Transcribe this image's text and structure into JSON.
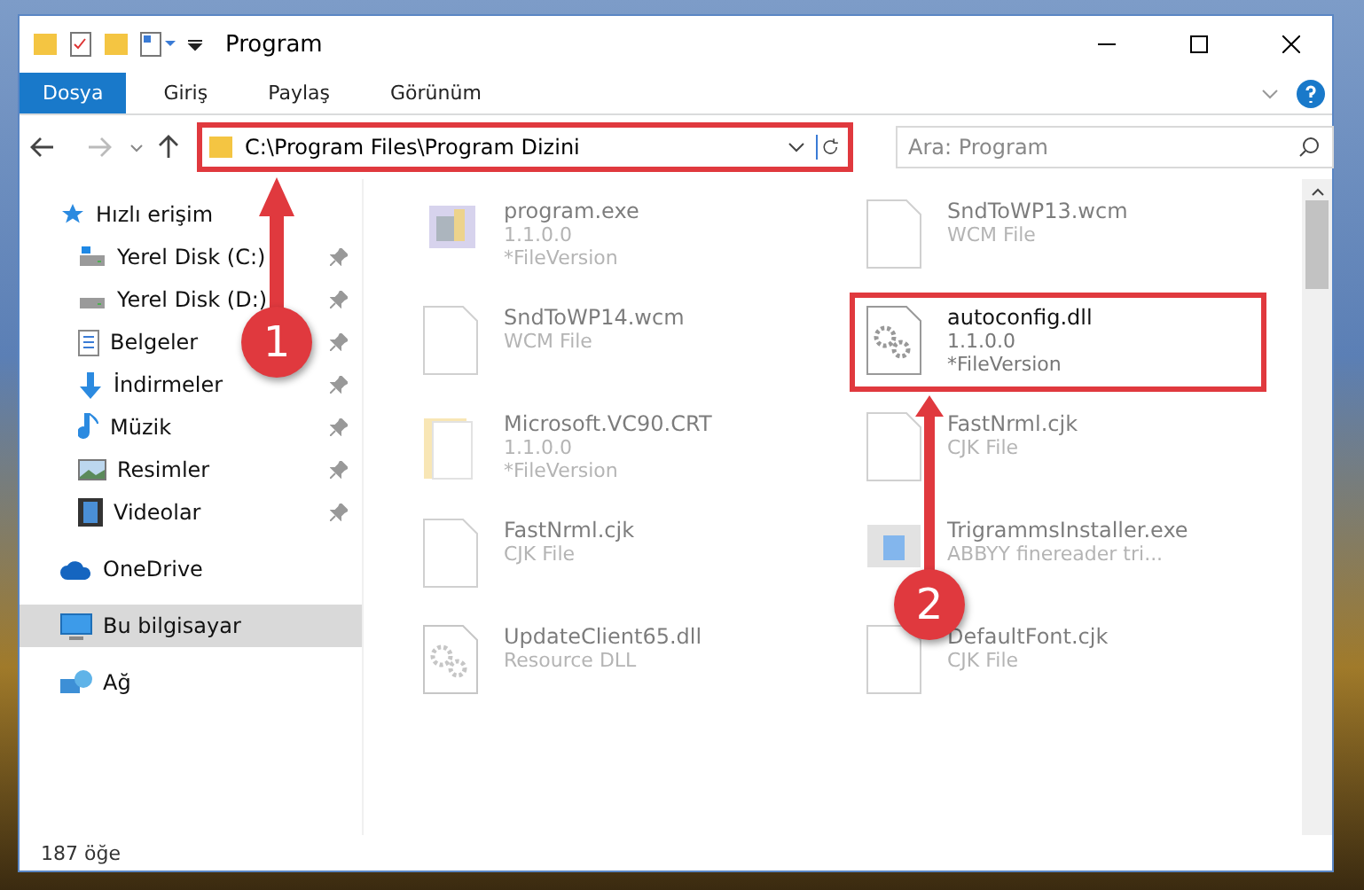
{
  "window": {
    "title": "Program"
  },
  "ribbon_tabs": [
    {
      "label": "Dosya",
      "selected": true
    },
    {
      "label": "Giriş",
      "selected": false
    },
    {
      "label": "Paylaş",
      "selected": false
    },
    {
      "label": "Görünüm",
      "selected": false
    }
  ],
  "address_bar": {
    "path": "C:\\Program Files\\Program Dizini",
    "highlighted": true
  },
  "search": {
    "placeholder": "Ara: Program"
  },
  "navigation": [
    {
      "label": "Hızlı erişim",
      "kind": "star",
      "selected": false,
      "children": [
        {
          "label": "Yerel Disk (C:)",
          "kind": "drivec",
          "pinned": true
        },
        {
          "label": "Yerel Disk (D:)",
          "kind": "drive",
          "pinned": true
        },
        {
          "label": "Belgeler",
          "kind": "document",
          "pinned": true
        },
        {
          "label": "İndirmeler",
          "kind": "download",
          "pinned": true
        },
        {
          "label": "Müzik",
          "kind": "music",
          "pinned": true
        },
        {
          "label": "Resimler",
          "kind": "picture",
          "pinned": true
        },
        {
          "label": "Videolar",
          "kind": "video",
          "pinned": true
        }
      ]
    },
    {
      "label": "OneDrive",
      "kind": "cloud",
      "selected": false
    },
    {
      "label": "Bu bilgisayar",
      "kind": "computer",
      "selected": true
    },
    {
      "label": "Ağ",
      "kind": "network",
      "selected": false
    }
  ],
  "files": [
    {
      "name": "program.exe",
      "details": [
        "1.1.0.0",
        "*FileVersion"
      ],
      "kind": "app",
      "highlighted": false,
      "blurred": true
    },
    {
      "name": "SndToWP13.wcm",
      "details": [
        "WCM File"
      ],
      "kind": "file",
      "highlighted": false,
      "blurred": true
    },
    {
      "name": "SndToWP14.wcm",
      "details": [
        "WCM File"
      ],
      "kind": "file",
      "highlighted": false,
      "blurred": true
    },
    {
      "name": "autoconfig.dll",
      "details": [
        "1.1.0.0",
        "*FileVersion"
      ],
      "kind": "gear",
      "highlighted": true,
      "blurred": false
    },
    {
      "name": "Microsoft.VC90.CRT",
      "details": [
        "1.1.0.0",
        "*FileVersion"
      ],
      "kind": "folder",
      "highlighted": false,
      "blurred": true
    },
    {
      "name": "FastNrml.cjk",
      "details": [
        "CJK File"
      ],
      "kind": "file",
      "highlighted": false,
      "blurred": true
    },
    {
      "name": "FastNrml.cjk",
      "details": [
        "CJK File"
      ],
      "kind": "file",
      "highlighted": false,
      "blurred": true
    },
    {
      "name": "TrigrammsInstaller.exe",
      "details": [
        "ABBYY finereader tri..."
      ],
      "kind": "installer",
      "highlighted": false,
      "blurred": true
    },
    {
      "name": "UpdateClient65.dll",
      "details": [
        "Resource DLL"
      ],
      "kind": "gear",
      "highlighted": false,
      "blurred": true
    },
    {
      "name": "DefaultFont.cjk",
      "details": [
        "CJK File"
      ],
      "kind": "file",
      "highlighted": false,
      "blurred": true
    }
  ],
  "status_bar": {
    "count": "187 öğe"
  },
  "annotations": [
    {
      "label": "1"
    },
    {
      "label": "2"
    }
  ]
}
